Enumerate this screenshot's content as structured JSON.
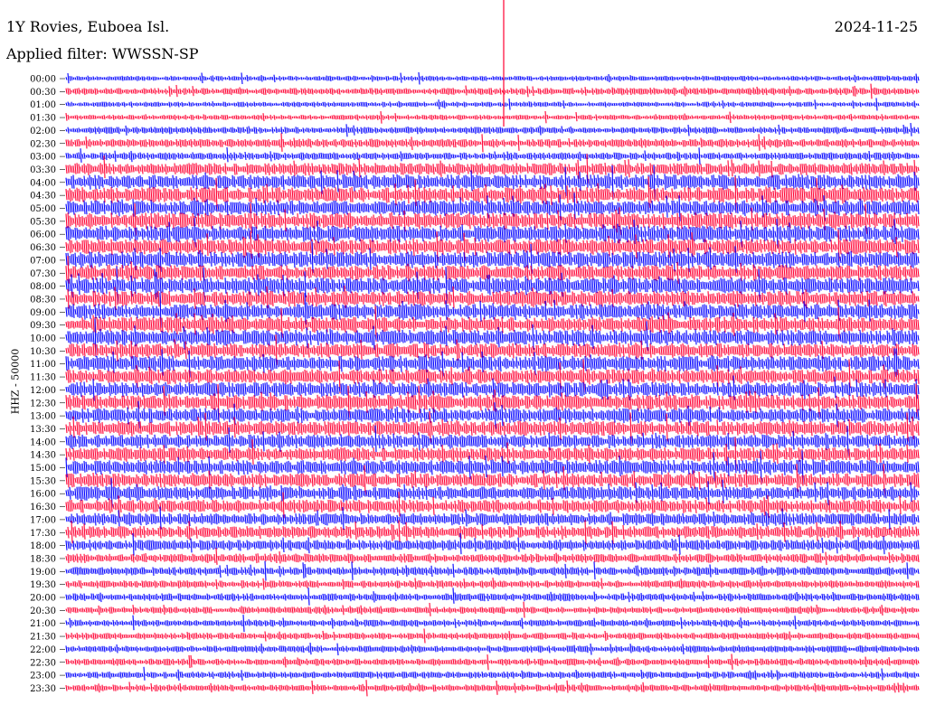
{
  "header": {
    "station": "1Y Rovies, Euboea Isl.",
    "date": "2024-11-25",
    "filter": "Applied filter: WWSSN-SP"
  },
  "channel_label": "HHZ - 50000",
  "chart_data": {
    "type": "line",
    "title": "1Y Rovies, Euboea Isl.",
    "ylabel": "HHZ - 50000",
    "row_labels": [
      "00:00",
      "00:30",
      "01:00",
      "01:30",
      "02:00",
      "02:30",
      "03:00",
      "03:30",
      "04:00",
      "04:30",
      "05:00",
      "05:30",
      "06:00",
      "06:30",
      "07:00",
      "07:30",
      "08:00",
      "08:30",
      "09:00",
      "09:30",
      "10:00",
      "10:30",
      "11:00",
      "11:30",
      "12:00",
      "12:30",
      "13:00",
      "13:30",
      "14:00",
      "14:30",
      "15:00",
      "15:30",
      "16:00",
      "16:30",
      "17:00",
      "17:30",
      "18:00",
      "18:30",
      "19:00",
      "19:30",
      "20:00",
      "20:30",
      "21:00",
      "21:30",
      "22:00",
      "22:30",
      "23:00",
      "23:30"
    ],
    "colors": [
      "#0000ff",
      "#ff0033"
    ],
    "grid": false,
    "legend": "none",
    "relative_noise_amplitude": [
      0.35,
      0.45,
      0.35,
      0.35,
      0.45,
      0.55,
      0.5,
      0.8,
      0.95,
      1.0,
      1.0,
      1.05,
      1.05,
      1.0,
      1.05,
      1.0,
      1.05,
      1.0,
      1.0,
      1.0,
      1.0,
      0.95,
      1.0,
      0.95,
      0.95,
      1.0,
      0.95,
      0.95,
      0.9,
      0.9,
      0.95,
      0.9,
      0.9,
      0.85,
      0.8,
      0.8,
      0.7,
      0.6,
      0.55,
      0.5,
      0.5,
      0.45,
      0.45,
      0.45,
      0.45,
      0.45,
      0.45,
      0.45
    ]
  }
}
